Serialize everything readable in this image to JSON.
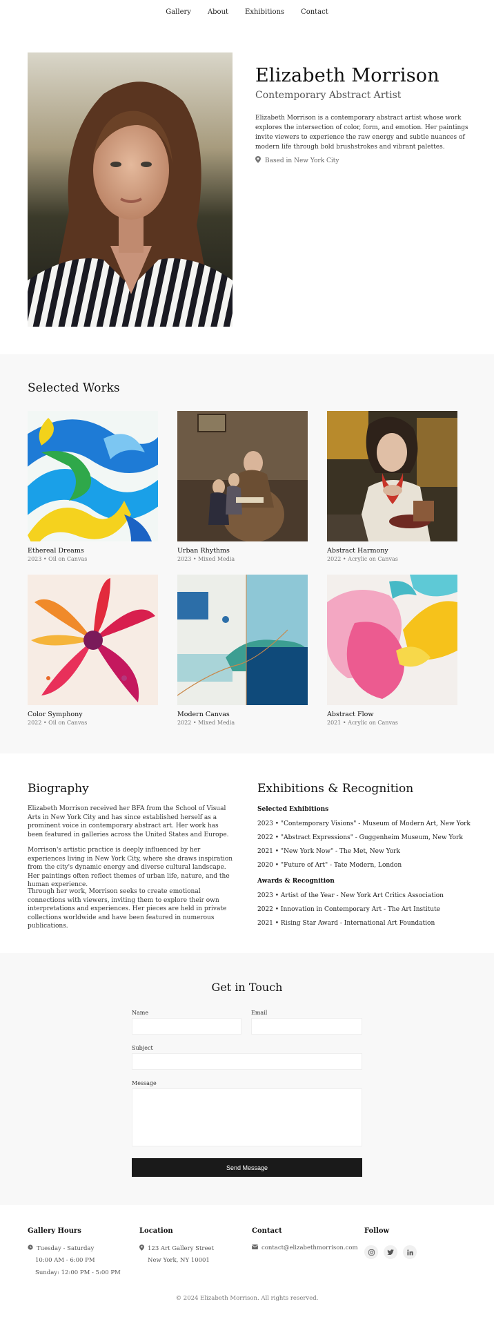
{
  "nav": [
    "Gallery",
    "About",
    "Exhibitions",
    "Contact"
  ],
  "hero": {
    "name": "Elizabeth Morrison",
    "subtitle": "Contemporary Abstract Artist",
    "bio": "Elizabeth Morrison is a contemporary abstract artist whose work explores the intersection of color, form, and emotion. Her paintings invite viewers to experience the raw energy and subtle nuances of modern life through bold brushstrokes and vibrant palettes.",
    "location": "Based in New York City",
    "location_icon": "map-pin-icon"
  },
  "works": {
    "title": "Selected Works",
    "items": [
      {
        "title": "Ethereal Dreams",
        "meta": "2023 • Oil on Canvas"
      },
      {
        "title": "Urban Rhythms",
        "meta": "2023 • Mixed Media"
      },
      {
        "title": "Abstract Harmony",
        "meta": "2022 • Acrylic on Canvas"
      },
      {
        "title": "Color Symphony",
        "meta": "2022 • Oil on Canvas"
      },
      {
        "title": "Modern Canvas",
        "meta": "2022 • Mixed Media"
      },
      {
        "title": "Abstract Flow",
        "meta": "2021 • Acrylic on Canvas"
      }
    ]
  },
  "biography": {
    "title": "Biography",
    "paragraphs": [
      "Elizabeth Morrison received her BFA from the School of Visual Arts in New York City and has since established herself as a prominent voice in contemporary abstract art. Her work has been featured in galleries across the United States and Europe.",
      "Morrison's artistic practice is deeply influenced by her experiences living in New York City, where she draws inspiration from the city's dynamic energy and diverse cultural landscape. Her paintings often reflect themes of urban life, nature, and the human experience.",
      "Through her work, Morrison seeks to create emotional connections with viewers, inviting them to explore their own interpretations and experiences. Her pieces are held in private collections worldwide and have been featured in numerous publications."
    ]
  },
  "exhibitions": {
    "title": "Exhibitions & Recognition",
    "selected_label": "Selected Exhibitions",
    "selected": [
      "2023 • \"Contemporary Visions\" - Museum of Modern Art, New York",
      "2022 • \"Abstract Expressions\" - Guggenheim Museum, New York",
      "2021 • \"New York Now\" - The Met, New York",
      "2020 • \"Future of Art\" - Tate Modern, London"
    ],
    "awards_label": "Awards & Recognition",
    "awards": [
      "2023 • Artist of the Year - New York Art Critics Association",
      "2022 • Innovation in Contemporary Art - The Art Institute",
      "2021 • Rising Star Award - International Art Foundation"
    ]
  },
  "contact_form": {
    "title": "Get in Touch",
    "name_label": "Name",
    "email_label": "Email",
    "subject_label": "Subject",
    "message_label": "Message",
    "name_value": "",
    "email_value": "",
    "subject_value": "",
    "message_value": "",
    "send_label": "Send Message"
  },
  "footer": {
    "hours_title": "Gallery Hours",
    "hours_days": "Tuesday - Saturday",
    "hours_time": "10:00 AM - 6:00 PM",
    "hours_sunday": "Sunday: 12:00 PM - 5:00 PM",
    "location_title": "Location",
    "address_line1": "123 Art Gallery Street",
    "address_line2": "New York, NY 10001",
    "contact_title": "Contact",
    "email": "contact@elizabethmorrison.com",
    "follow_title": "Follow",
    "social_icons": [
      "instagram-icon",
      "twitter-icon",
      "linkedin-icon"
    ],
    "copyright": "© 2024 Elizabeth Morrison. All rights reserved."
  },
  "colors": {
    "section_bg": "#f8f8f8",
    "button_bg": "#1a1a1a",
    "text": "#222222"
  }
}
